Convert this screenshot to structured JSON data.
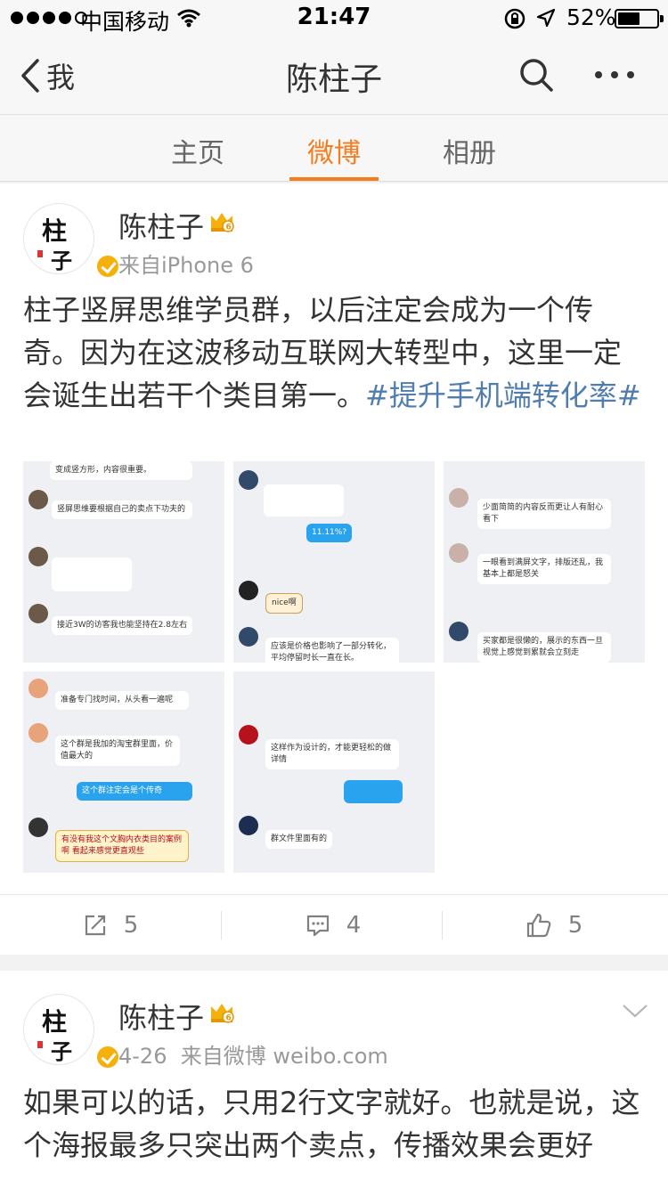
{
  "status_bar": {
    "carrier": "中国移动",
    "time": "21:47",
    "battery": "52%"
  },
  "nav": {
    "back_label": "我",
    "title": "陈柱子"
  },
  "tabs": [
    {
      "label": "主页"
    },
    {
      "label": "微博"
    },
    {
      "label": "相册"
    }
  ],
  "posts": [
    {
      "user": "陈柱子",
      "source": "来自iPhone 6",
      "text": "柱子竖屏思维学员群，以后注定会成为一个传奇。因为在这波移动互联网大转型中，这里一定会诞生出若干个类目第一。",
      "hashtag": "#提升手机端转化率#",
      "images": [
        {
          "bubbles": [
            "变成竖方形，内容很重要。",
            "竖屏思维要根据自己的卖点下功夫的",
            "接近3W的访客我也能坚持在2.8左右"
          ]
        },
        {
          "bubbles": [
            "11.11%?",
            "nice啊",
            "应该是价格也影响了一部分转化，平均停留时长一直在长。"
          ]
        },
        {
          "bubbles": [
            "少面简简的内容反而更让人有耐心看下",
            "一眼看到满屏文字，排版还乱，我基本上都是怒关",
            "买家都是很懒的，展示的东西一旦视觉上感觉到累就会立刻走"
          ]
        },
        {
          "bubbles": [
            "准备专门找时间，从头看一遍呢",
            "这个群是我加的淘宝群里面，价值最大的",
            "这个群注定会是个传奇",
            "有没有我这个文胸内衣类目的案例啊 看起来感觉更直观些"
          ]
        },
        {
          "bubbles": [
            "这样作为设计的，才能更轻松的做详情",
            "群文件里面有的"
          ]
        }
      ],
      "actions": {
        "repost": "5",
        "comment": "4",
        "like": "5"
      }
    },
    {
      "user": "陈柱子",
      "date": "4-26",
      "source": "来自微博 weibo.com",
      "text": "如果可以的话，只用2行文字就好。也就是说，这个海报最多只突出两个卖点，传播效果会更好"
    }
  ],
  "colors": {
    "accent": "#f77c1e",
    "link": "#507daf",
    "chat_blue": "#2aa3ee",
    "verified_gold": "#f6b00c"
  }
}
